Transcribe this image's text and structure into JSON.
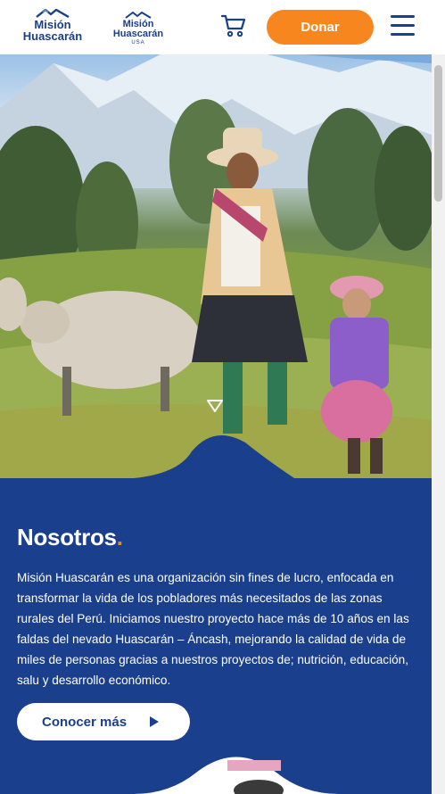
{
  "header": {
    "logo_primary": {
      "line1": "Misión",
      "line2": "Huascarán"
    },
    "logo_usa": {
      "line1": "Misión",
      "line2": "Huascarán",
      "tag": "USA"
    },
    "donate_label": "Donar",
    "cart_icon": "cart-icon",
    "menu_icon": "hamburger-menu-icon"
  },
  "hero": {
    "scroll_icon": "chevron-down-outline-icon"
  },
  "about": {
    "title": "Nosotros",
    "title_dot": ".",
    "text": "Misión Huascarán es una organización sin fines de lucro, enfocada en transformar la vida de los pobladores más necesitados de las zonas rurales del Perú. Iniciamos nuestro proyecto hace más de 10 años en las faldas del nevado Huascarán – Áncash, mejorando la calidad de vida de miles de personas gracias a nuestros proyectos de; nutrición, educación, salu y desarrollo económico.",
    "cta_label": "Conocer más"
  },
  "colors": {
    "brand_blue": "#1a3f8c",
    "accent_orange": "#f7861f"
  }
}
